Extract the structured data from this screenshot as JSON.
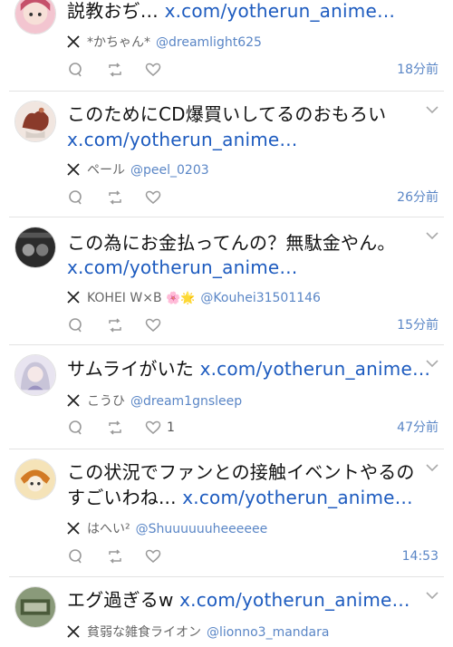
{
  "tweets": [
    {
      "line1": {
        "plain": "説教おぢ… ",
        "link": "x.com/yotherun_anime…"
      },
      "line2": null,
      "display_name": "*かちゃん*",
      "handle": "@dreamlight625",
      "likes": "",
      "time": "18分前",
      "avatar_colors": [
        "#f3c5d0",
        "#c5506a"
      ]
    },
    {
      "line1": {
        "plain": "このためにCD爆買いしてるのおもろい",
        "link": ""
      },
      "line2": {
        "plain": "",
        "link": "x.com/yotherun_anime…"
      },
      "display_name": "ペール",
      "handle": "@peel_0203",
      "likes": "",
      "time": "26分前",
      "avatar_colors": [
        "#f1e6e0",
        "#8a3a2a"
      ]
    },
    {
      "line1": {
        "plain": "この為にお金払ってんの？無駄金やん。",
        "link": ""
      },
      "line2": {
        "plain": "",
        "link": "x.com/yotherun_anime…"
      },
      "display_name": "KOHEI W×B",
      "display_emoji": "🌸🌟",
      "handle": "@Kouhei31501146",
      "likes": "",
      "time": "15分前",
      "avatar_colors": [
        "#2b2b2b",
        "#9a9a9a"
      ]
    },
    {
      "line1": {
        "plain": "サムライがいた ",
        "link": "x.com/yotherun_anime…"
      },
      "line2": null,
      "display_name": "こうひ",
      "handle": "@dream1gnsleep",
      "likes": "1",
      "time": "47分前",
      "avatar_colors": [
        "#e8e4f0",
        "#9a92c0"
      ]
    },
    {
      "line1": {
        "plain": "この状況でファンとの接触イベントやるの",
        "link": ""
      },
      "line2": {
        "plain": "すごいわね... ",
        "link": "x.com/yotherun_anime…"
      },
      "display_name": "はへい²",
      "handle": "@Shuuuuuuheeeeee",
      "likes": "",
      "time": "14:53",
      "avatar_colors": [
        "#f5e3b8",
        "#d27a25"
      ]
    },
    {
      "line1": {
        "plain": "エグ過ぎるw ",
        "link": "x.com/yotherun_anime…"
      },
      "line2": null,
      "display_name": "貧弱な雑食ライオン",
      "handle": "@lionno3_mandara",
      "likes": "",
      "time": "",
      "avatar_colors": [
        "#8a9a7a",
        "#4a5a3a"
      ]
    }
  ],
  "icons": {
    "x_logo": "x-logo-icon",
    "reply": "reply-icon",
    "retweet": "retweet-icon",
    "like": "heart-icon",
    "menu": "chevron-down-icon"
  },
  "colors": {
    "link": "#1d5bbf",
    "handle": "#5a86c6",
    "muted": "#999999"
  }
}
